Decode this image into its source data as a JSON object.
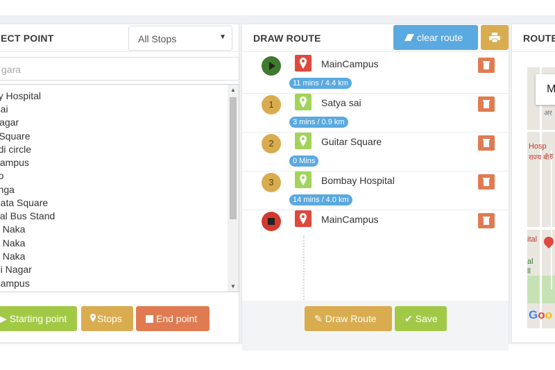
{
  "left_panel": {
    "title": "ECT POINT",
    "stop_filter": {
      "selected": "All Stops"
    },
    "search": {
      "value": "gara"
    },
    "stops": [
      "bay Hospital",
      "a sai",
      "yNagar",
      "ar Square",
      "godi circle",
      "nCampus",
      "ndo",
      "ganga",
      "i Mata Square",
      "gwal Bus Stand",
      "ow Naka",
      "ow Naka",
      "ow Naka",
      "hali Nagar",
      "n campus"
    ],
    "buttons": {
      "starting_point": "Starting point",
      "stops": "Stops",
      "end_point": "End point"
    }
  },
  "middle_panel": {
    "title": "DRAW ROUTE",
    "clear_route_label": "clear route",
    "route": [
      {
        "marker": "start-icon",
        "name": "MainCampus",
        "pin": "red",
        "time": "11 mins / 4.4 km"
      },
      {
        "marker": "1",
        "name": "Satya sai",
        "pin": "green",
        "time": "3 mins / 0.9 km"
      },
      {
        "marker": "2",
        "name": "Guitar Square",
        "pin": "green",
        "time": "0 Mins"
      },
      {
        "marker": "3",
        "name": "Bombay Hospital",
        "pin": "green",
        "time": "14 mins / 4.0 km"
      },
      {
        "marker": "stop-icon",
        "name": "MainCampus",
        "pin": "red",
        "time": ""
      }
    ],
    "buttons": {
      "draw_route": "Draw Route",
      "save": "Save"
    }
  },
  "right_panel": {
    "title": "ROUTE",
    "map_card_letter": "M",
    "map_labels": [
      "अर",
      "Hosp",
      "ह",
      "राज्य बी",
      "ital",
      "al",
      "ll"
    ],
    "map_logo": "Goo"
  },
  "colors": {
    "green": "#a2c946",
    "gold": "#d9ac4f",
    "orange": "#e07b51",
    "blue": "#5aa9e0",
    "red": "#e0483c"
  }
}
